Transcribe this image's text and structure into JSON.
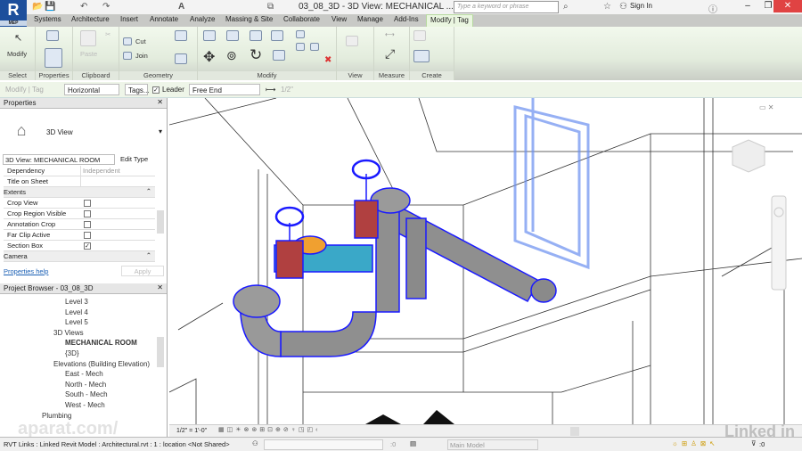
{
  "app": {
    "logo": "R",
    "logo_sub": "MEP",
    "title": "03_08_3D - 3D View: MECHANICAL ...",
    "search_placeholder": "Type a keyword or phrase",
    "sign_in": "Sign In"
  },
  "tabs": [
    "Systems",
    "Architecture",
    "Insert",
    "Annotate",
    "Analyze",
    "Massing & Site",
    "Collaborate",
    "View",
    "Manage",
    "Add-Ins",
    "Modify | Tag"
  ],
  "ribbon": {
    "modify": "Modify",
    "cut": "Cut",
    "join": "Join",
    "paste": "Paste",
    "panels": [
      "Select",
      "Properties",
      "Clipboard",
      "Geometry",
      "Modify",
      "View",
      "Measure",
      "Create"
    ]
  },
  "options": {
    "context": "Modify | Tag",
    "orientation": "Horizontal",
    "tags_button": "Tags...",
    "leader_label": "Leader",
    "leader_checked": true,
    "end": "Free End",
    "length": "1/2\""
  },
  "properties": {
    "title": "Properties",
    "type_name": "3D View",
    "selector": "3D View: MECHANICAL ROOM",
    "edit_type": "Edit Type",
    "rows": [
      {
        "k": "Dependency",
        "v": "Independent",
        "kind": "text"
      },
      {
        "k": "Title on Sheet",
        "v": "",
        "kind": "text"
      },
      {
        "k": "Extents",
        "kind": "group"
      },
      {
        "k": "Crop View",
        "checked": false,
        "kind": "check"
      },
      {
        "k": "Crop Region Visible",
        "checked": false,
        "kind": "check"
      },
      {
        "k": "Annotation Crop",
        "checked": false,
        "kind": "check"
      },
      {
        "k": "Far Clip Active",
        "checked": false,
        "kind": "check"
      },
      {
        "k": "Section Box",
        "checked": true,
        "kind": "check"
      },
      {
        "k": "Camera",
        "kind": "group"
      }
    ],
    "help": "Properties help",
    "apply": "Apply"
  },
  "browser": {
    "title": "Project Browser - 03_08_3D",
    "items": [
      {
        "label": "Level 3",
        "indent": 3
      },
      {
        "label": "Level 4",
        "indent": 3
      },
      {
        "label": "Level 5",
        "indent": 3
      },
      {
        "label": "3D Views",
        "indent": 2
      },
      {
        "label": "MECHANICAL ROOM",
        "indent": 3,
        "bold": true
      },
      {
        "label": "{3D}",
        "indent": 3
      },
      {
        "label": "Elevations (Building Elevation)",
        "indent": 2
      },
      {
        "label": "East - Mech",
        "indent": 3
      },
      {
        "label": "North - Mech",
        "indent": 3
      },
      {
        "label": "South - Mech",
        "indent": 3
      },
      {
        "label": "West - Mech",
        "indent": 3
      },
      {
        "label": "Plumbing",
        "indent": 1
      }
    ]
  },
  "viewcontrol": {
    "scale": "1/2\" = 1'-0\""
  },
  "status": {
    "text": "RVT Links : Linked Revit Model : Architectural.rvt : 1 : location <Not Shared>",
    "worksets": ":0",
    "model": "Main Model",
    "filter": ":0"
  },
  "watermarks": {
    "linkedin": "Linked in",
    "aparat": "aparat.com/"
  },
  "colors": {
    "pipe": "#8f8f8f",
    "selection": "#1a1aff",
    "valve": "#c0392b",
    "fitting": "#3aa8c8",
    "accent": "#eaf6e0"
  }
}
